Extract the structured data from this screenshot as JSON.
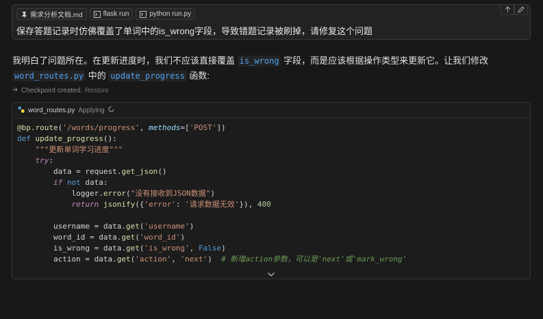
{
  "user_message": {
    "chips": [
      {
        "icon": "pin-icon",
        "label": "需求分析文档.md"
      },
      {
        "icon": "terminal-icon",
        "label": "flask run"
      },
      {
        "icon": "terminal-icon",
        "label": "python run.py"
      }
    ],
    "text": "保存答题记录时仿佛覆盖了单词中的is_wrong字段，导致错题记录被刷掉，请修复这个问题"
  },
  "assistant": {
    "part1": "我明白了问题所在。在更新进度时，我们不应该直接覆盖",
    "code1": "is_wrong",
    "part2": "字段，而是应该根据操作类型来更新它。让我们修改",
    "code2": "word_routes.py",
    "part3": "中的",
    "code3": "update_progress",
    "part4": "函数:"
  },
  "checkpoint": {
    "text": "Checkpoint created.",
    "restore": "Restore"
  },
  "code_block": {
    "filename": "word_routes.py",
    "status": "Applying",
    "lines": {
      "l1_route": "'/words/progress'",
      "l1_methods": "'POST'",
      "l2_name": "update_progress",
      "l3_doc": "\"\"\"更新单词学习进度\"\"\"",
      "l7_msg": "\"没有接收到JSON数据\"",
      "l8_key": "'error'",
      "l8_val": "'请求数据无效'",
      "l8_code": "400",
      "l10_key": "'username'",
      "l11_key": "'word_id'",
      "l12_key": "'is_wrong'",
      "l13_key": "'action'",
      "l13_default": "'next'",
      "l13_comment": "# 新增action参数，可以是'next'或'mark_wrong'"
    }
  }
}
